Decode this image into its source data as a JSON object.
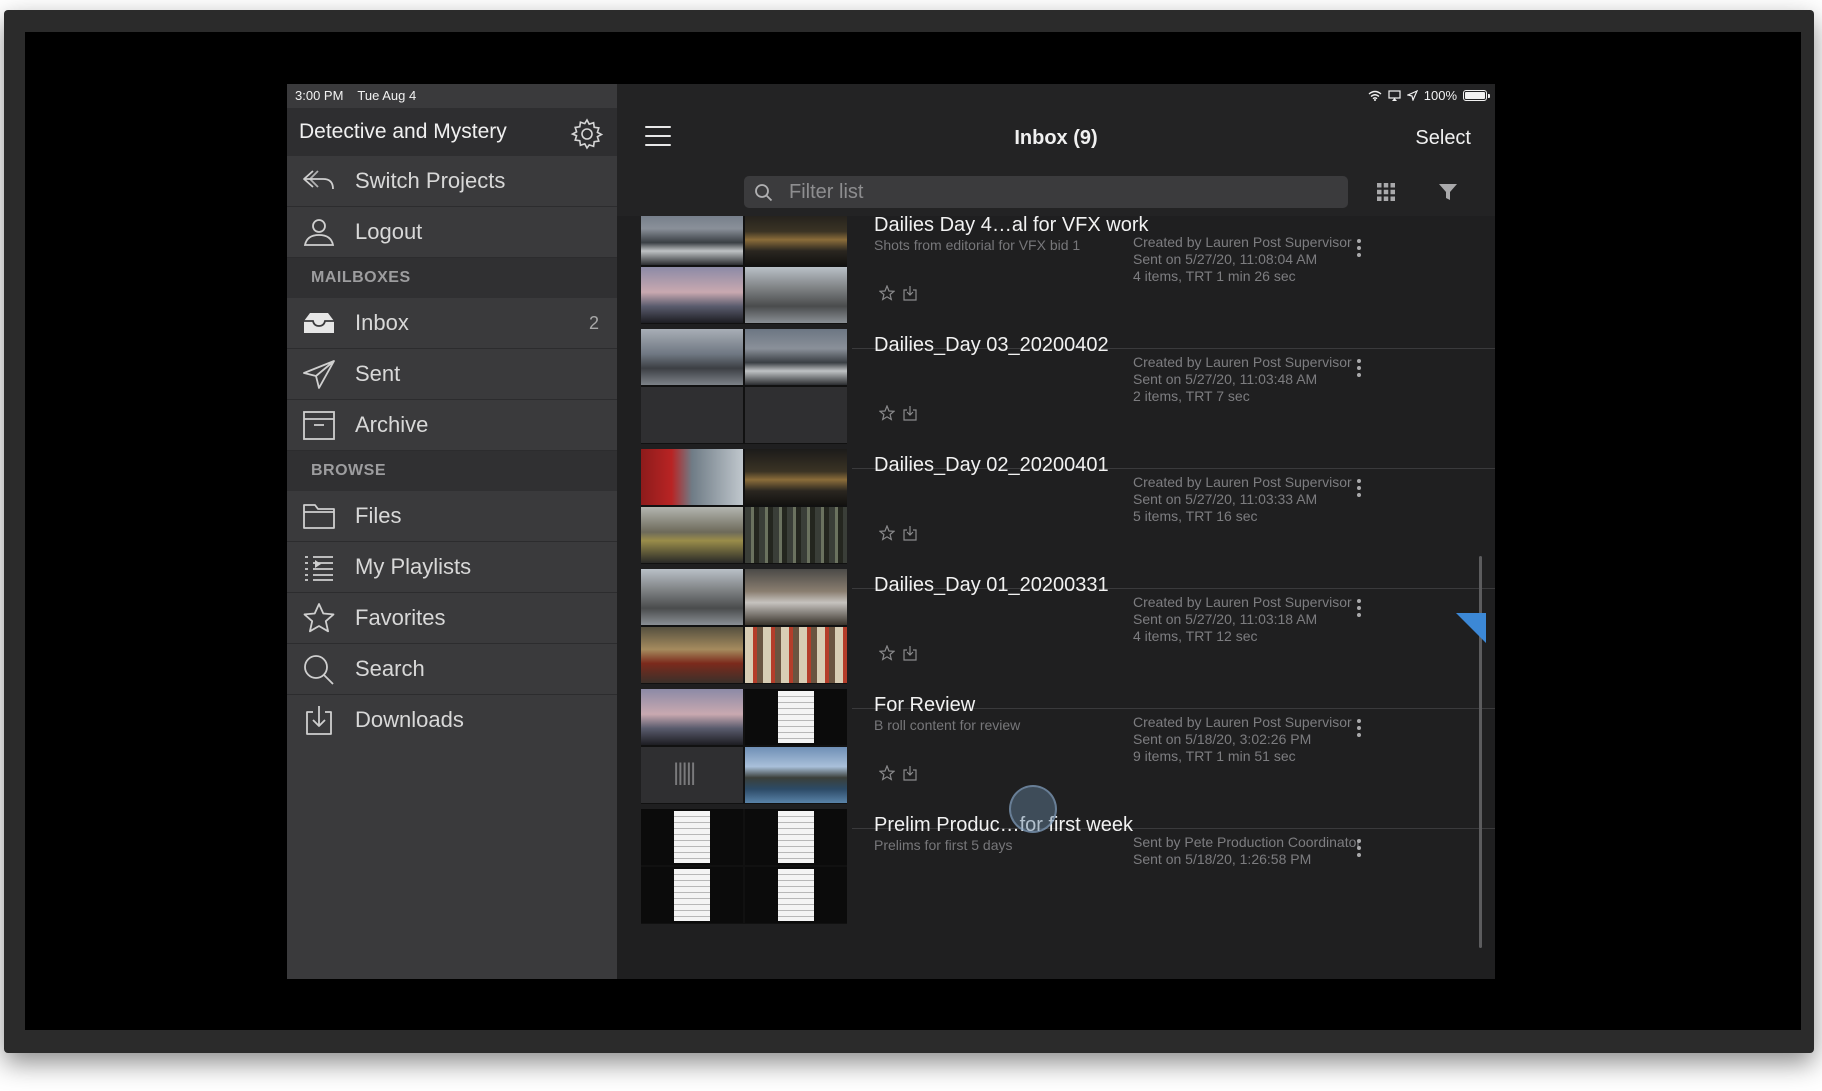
{
  "status": {
    "time": "3:00 PM",
    "date": "Tue Aug 4",
    "battery": "100%"
  },
  "sidebar": {
    "project_title": "Detective and Mystery",
    "top_items": [
      {
        "label": "Switch Projects",
        "icon": "switch-projects-icon"
      },
      {
        "label": "Logout",
        "icon": "user-icon"
      }
    ],
    "mailboxes_header": "MAILBOXES",
    "mailboxes": [
      {
        "label": "Inbox",
        "count": "2",
        "icon": "inbox-icon"
      },
      {
        "label": "Sent",
        "count": "",
        "icon": "paper-plane-icon"
      },
      {
        "label": "Archive",
        "count": "",
        "icon": "archive-box-icon"
      }
    ],
    "browse_header": "BROWSE",
    "browse": [
      {
        "label": "Files",
        "icon": "folder-icon"
      },
      {
        "label": "My Playlists",
        "icon": "playlist-icon"
      },
      {
        "label": "Favorites",
        "icon": "star-icon"
      },
      {
        "label": "Search",
        "icon": "search-icon"
      },
      {
        "label": "Downloads",
        "icon": "download-icon"
      }
    ]
  },
  "main": {
    "title": "Inbox (9)",
    "select_label": "Select",
    "filter_placeholder": "Filter list",
    "items": [
      {
        "title": "Dailies Day 4…al for VFX work",
        "subtitle": "Shots from editorial for VFX bid 1",
        "meta1": "Created by Lauren Post Supervisor",
        "meta2": "Sent on 5/27/20, 11:08:04 AM",
        "meta3": "4 items, TRT 1 min 26 sec"
      },
      {
        "title": "Dailies_Day 03_20200402",
        "subtitle": "",
        "meta1": "Created by Lauren Post Supervisor",
        "meta2": "Sent on 5/27/20, 11:03:48 AM",
        "meta3": "2 items, TRT 7 sec"
      },
      {
        "title": "Dailies_Day 02_20200401",
        "subtitle": "",
        "meta1": "Created by Lauren Post Supervisor",
        "meta2": "Sent on 5/27/20, 11:03:33 AM",
        "meta3": "5 items, TRT 16 sec"
      },
      {
        "title": "Dailies_Day 01_20200331",
        "subtitle": "",
        "meta1": "Created by Lauren Post Supervisor",
        "meta2": "Sent on 5/27/20, 11:03:18 AM",
        "meta3": "4 items, TRT 12 sec"
      },
      {
        "title": "For Review",
        "subtitle": "B roll content for review",
        "meta1": "Created by Lauren Post Supervisor",
        "meta2": "Sent on 5/18/20, 3:02:26 PM",
        "meta3": "9 items, TRT 1 min 51 sec"
      },
      {
        "title": "Prelim Produc…for first week",
        "subtitle": "Prelims for first 5 days",
        "meta1": "Sent by Pete Production Coordinator",
        "meta2": "Sent on 5/18/20, 1:26:58 PM",
        "meta3": ""
      }
    ]
  },
  "colors": {
    "sidebar_bg": "#3a3a3c",
    "main_bg": "#1f1f20",
    "accent_triangle": "#3c88d6"
  }
}
